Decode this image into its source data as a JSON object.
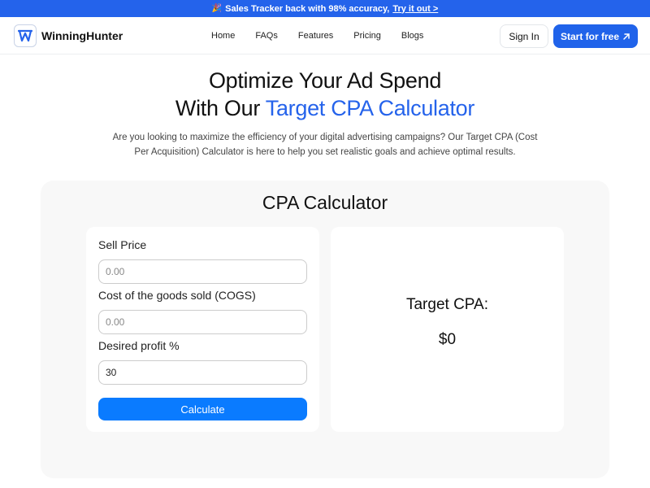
{
  "banner": {
    "emoji": "🎉",
    "text": "Sales Tracker back with 98% accuracy,",
    "link": "Try it out >"
  },
  "nav": {
    "brand": "WinningHunter",
    "links": [
      "Home",
      "FAQs",
      "Features",
      "Pricing",
      "Blogs"
    ],
    "signin": "Sign In",
    "start": "Start for free"
  },
  "hero": {
    "line1": "Optimize Your Ad Spend",
    "line2_prefix": "With Our ",
    "line2_accent": "Target CPA Calculator",
    "description": "Are you looking to maximize the efficiency of your digital advertising campaigns? Our Target CPA (Cost Per Acquisition) Calculator is here to help you set realistic goals and achieve optimal results."
  },
  "calculator": {
    "title": "CPA Calculator",
    "fields": [
      {
        "label": "Sell Price",
        "placeholder": "0.00",
        "value": ""
      },
      {
        "label": "Cost of the goods sold (COGS)",
        "placeholder": "0.00",
        "value": ""
      },
      {
        "label": "Desired profit %",
        "placeholder": "",
        "value": "30"
      }
    ],
    "button": "Calculate",
    "result_label": "Target CPA:",
    "result_value": "$0"
  },
  "colors": {
    "brand_blue": "#2563eb",
    "button_blue": "#0a7bff"
  }
}
